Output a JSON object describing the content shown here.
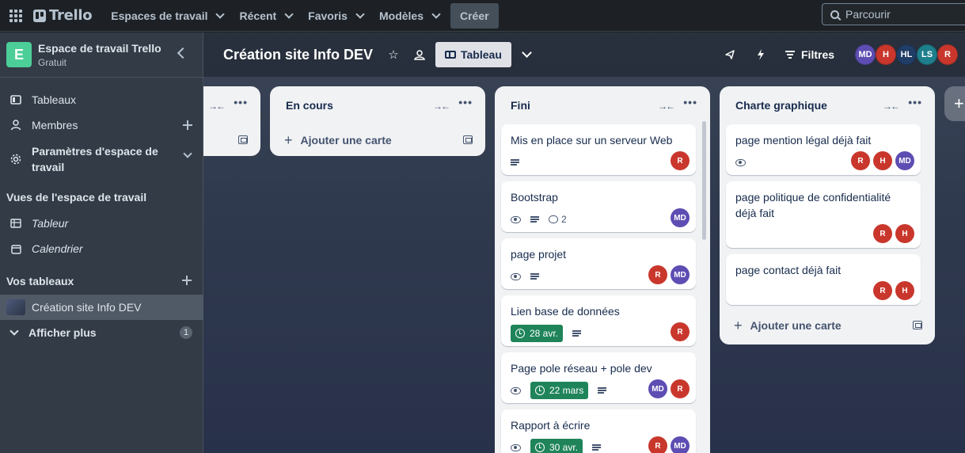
{
  "topnav": {
    "logo": "Trello",
    "workspaces": "Espaces de travail",
    "recent": "Récent",
    "favorites": "Favoris",
    "templates": "Modèles",
    "create": "Créer",
    "search_placeholder": "Parcourir"
  },
  "sidebar": {
    "workspace_badge": "E",
    "workspace_name": "Espace de travail Trello",
    "workspace_plan": "Gratuit",
    "items": [
      {
        "label": "Tableaux"
      },
      {
        "label": "Membres"
      },
      {
        "label": "Paramètres d'espace de travail"
      }
    ],
    "views_title": "Vues de l'espace de travail",
    "views": [
      {
        "label": "Tableur"
      },
      {
        "label": "Calendrier"
      }
    ],
    "boards_title": "Vos tableaux",
    "boards": [
      {
        "label": "Création site Info DEV"
      }
    ],
    "show_more": "Afficher plus",
    "show_more_count": "1"
  },
  "board": {
    "title": "Création site Info DEV",
    "view_label": "Tableau",
    "filters_label": "Filtres",
    "members": [
      {
        "initials": "MD",
        "color": "#5e4db2"
      },
      {
        "initials": "H",
        "color": "#c9372c"
      },
      {
        "initials": "HL",
        "color": "#1f3d66"
      },
      {
        "initials": "LS",
        "color": "#1d7f8c"
      },
      {
        "initials": "R",
        "color": "#c9372c"
      }
    ]
  },
  "lists": {
    "en_cours": {
      "title": "En cours",
      "add_card": "Ajouter une carte"
    },
    "fini": {
      "title": "Fini",
      "cards": [
        {
          "title": "Mis en place sur un serveur Web",
          "members": [
            "R"
          ]
        },
        {
          "title": "Bootstrap",
          "comments": "2",
          "members": [
            "MD"
          ]
        },
        {
          "title": "page projet",
          "members": [
            "R",
            "MD"
          ]
        },
        {
          "title": "Lien base de données",
          "due": "28 avr.",
          "members": [
            "R"
          ]
        },
        {
          "title": "Page pole réseau + pole dev",
          "due": "22 mars",
          "members": [
            "MD",
            "R"
          ]
        },
        {
          "title": "Rapport à écrire",
          "due": "30 avr.",
          "members": [
            "R",
            "MD"
          ]
        }
      ]
    },
    "charte": {
      "title": "Charte graphique",
      "cards": [
        {
          "title": "page mention légal déjà fait",
          "members": [
            "R",
            "H",
            "MD"
          ]
        },
        {
          "title": "page politique de confidentialité déjà fait",
          "members": [
            "R",
            "H"
          ]
        },
        {
          "title": "page contact déjà fait",
          "members": [
            "R",
            "H"
          ]
        }
      ],
      "add_card": "Ajouter une carte"
    }
  },
  "colors": {
    "accent_green": "#1f845a",
    "avatar_red": "#c9372c",
    "avatar_purple": "#5e4db2"
  }
}
